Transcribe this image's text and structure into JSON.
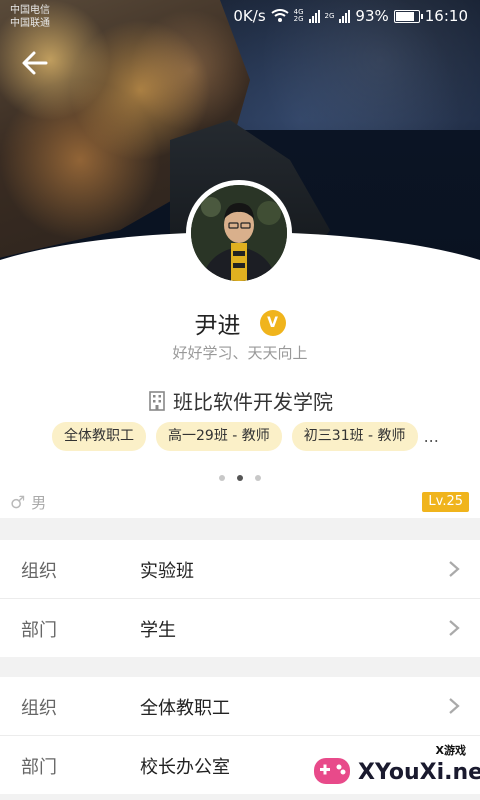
{
  "status_bar": {
    "carrier_1": "中国电信",
    "carrier_2": "中国联通",
    "speed": "0K/s",
    "net_1": "4G",
    "net_2": "2G",
    "battery": "93%",
    "time": "16:10"
  },
  "profile": {
    "name": "尹进",
    "badge": "V",
    "motto": "好好学习、天天向上",
    "school": "班比软件开发学院",
    "tags": [
      "全体教职工",
      "高一29班 - 教师",
      "初三31班 - 教师"
    ],
    "tags_more": "...",
    "gender": "男",
    "level": "Lv.25",
    "pager_total": 3,
    "pager_active": 1
  },
  "groups": [
    {
      "rows": [
        {
          "label": "组织",
          "value": "实验班"
        },
        {
          "label": "部门",
          "value": "学生"
        }
      ]
    },
    {
      "rows": [
        {
          "label": "组织",
          "value": "全体教职工"
        },
        {
          "label": "部门",
          "value": "校长办公室"
        }
      ]
    }
  ],
  "watermark": {
    "small": "X游戏",
    "big": "XYouXi.net"
  },
  "colors": {
    "accent": "#f0b41c",
    "chip_bg": "#fbf0c8"
  }
}
